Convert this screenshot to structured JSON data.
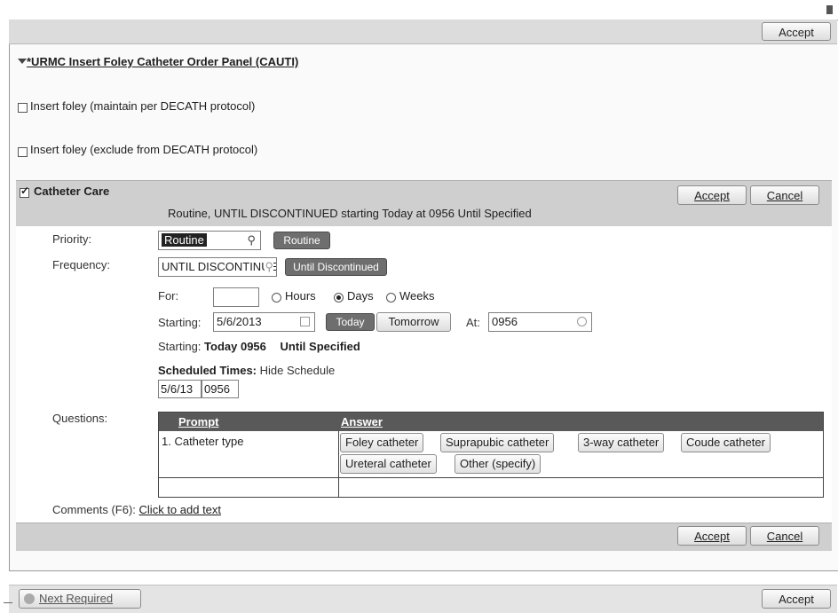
{
  "window": {
    "top_accept_label": "Accept",
    "bottom_accept_label": "Accept",
    "next_required_label": "Next Required"
  },
  "panel": {
    "title": "*URMC Insert Foley Catheter Order Panel (CAUTI)",
    "options": [
      {
        "label": "Insert foley (maintain per DECATH protocol)",
        "checked": false
      },
      {
        "label": "Insert foley (exclude from DECATH protocol)",
        "checked": false
      }
    ]
  },
  "order": {
    "title": "Catheter Care",
    "checked": true,
    "summary": "Routine, UNTIL DISCONTINUED starting Today at 0956 Until Specified",
    "accept_label": "Accept",
    "cancel_label": "Cancel",
    "priority_label": "Priority:",
    "priority_value": "Routine",
    "priority_button": "Routine",
    "frequency_label": "Frequency:",
    "frequency_value": "UNTIL DISCONTINUED",
    "frequency_button": "Until Discontinued",
    "for_label": "For:",
    "for_value": "",
    "duration_options": [
      {
        "label": "Hours",
        "selected": false
      },
      {
        "label": "Days",
        "selected": true
      },
      {
        "label": "Weeks",
        "selected": false
      }
    ],
    "starting_label": "Starting:",
    "starting_date": "5/6/2013",
    "today_button": "Today",
    "tomorrow_button": "Tomorrow",
    "at_label": "At:",
    "at_time": "0956",
    "starting_summary_label": "Starting:",
    "starting_summary_value": "Today 0956",
    "until_text": "Until Specified",
    "scheduled_label": "Scheduled Times:",
    "hide_schedule_label": "Hide Schedule",
    "schedule_date": "5/6/13",
    "schedule_time": "0956",
    "questions_label": "Questions:",
    "question_headers": {
      "prompt": "Prompt",
      "answer": "Answer"
    },
    "question_prompt": "1. Catheter type",
    "answers": [
      "Foley catheter",
      "Suprapubic catheter",
      "3-way catheter",
      "Coude catheter",
      "Ureteral catheter",
      "Other (specify)"
    ],
    "comments_label": "Comments (F6):",
    "comments_link": "Click to add text",
    "footer_accept": "Accept",
    "footer_cancel": "Cancel"
  }
}
